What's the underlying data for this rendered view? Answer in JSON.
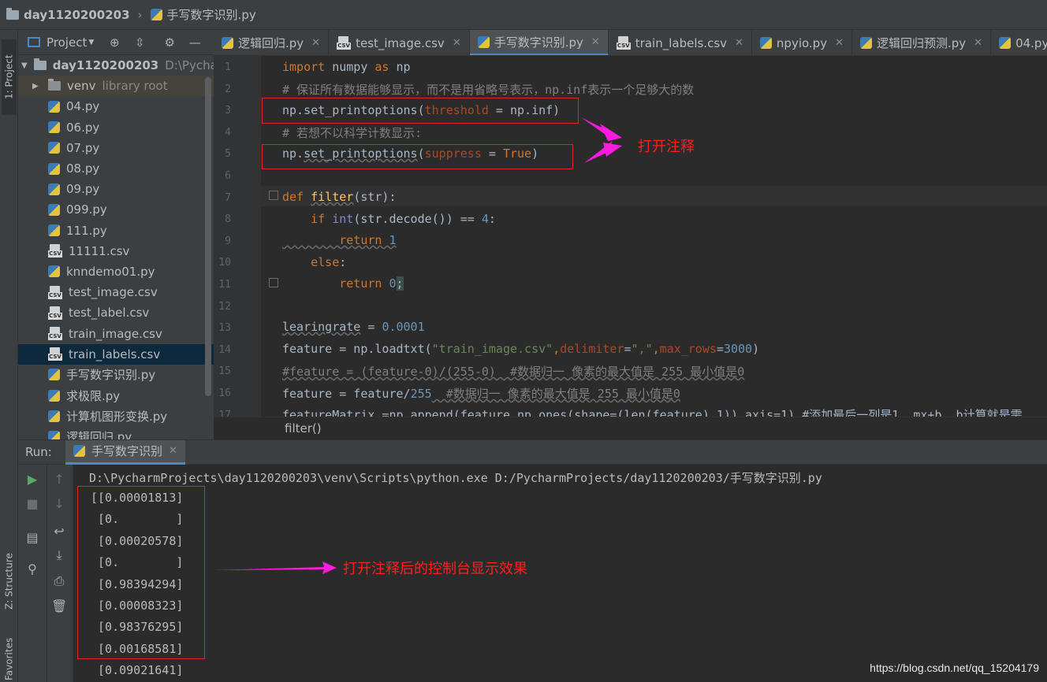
{
  "breadcrumb": {
    "project": "day1120200203",
    "file": "手写数字识别.py"
  },
  "side_tabs": {
    "project": "1: Project",
    "structure": "Z: Structure",
    "favorites": "Favorites"
  },
  "project_panel": {
    "title": "Project",
    "root": {
      "name": "day1120200203",
      "path": "D:\\Pycharm"
    },
    "venv": {
      "name": "venv",
      "hint": "library root"
    },
    "files": [
      {
        "name": "04.py",
        "type": "py"
      },
      {
        "name": "06.py",
        "type": "py"
      },
      {
        "name": "07.py",
        "type": "py"
      },
      {
        "name": "08.py",
        "type": "py"
      },
      {
        "name": "09.py",
        "type": "py"
      },
      {
        "name": "099.py",
        "type": "py"
      },
      {
        "name": "111.py",
        "type": "py"
      },
      {
        "name": "11111.csv",
        "type": "csv"
      },
      {
        "name": "knndemo01.py",
        "type": "py"
      },
      {
        "name": "test_image.csv",
        "type": "csv"
      },
      {
        "name": "test_label.csv",
        "type": "csv"
      },
      {
        "name": "train_image.csv",
        "type": "csv"
      },
      {
        "name": "train_labels.csv",
        "type": "csv",
        "selected": true
      },
      {
        "name": "手写数字识别.py",
        "type": "py"
      },
      {
        "name": "求极限.py",
        "type": "py"
      },
      {
        "name": "计算机图形变换.py",
        "type": "py"
      },
      {
        "name": "逻辑回归.py",
        "type": "py"
      }
    ]
  },
  "tabs": [
    {
      "label": "逻辑回归.py",
      "type": "py"
    },
    {
      "label": "test_image.csv",
      "type": "csv"
    },
    {
      "label": "手写数字识别.py",
      "type": "py",
      "active": true
    },
    {
      "label": "train_labels.csv",
      "type": "csv"
    },
    {
      "label": "npyio.py",
      "type": "py"
    },
    {
      "label": "逻辑回归预测.py",
      "type": "py"
    },
    {
      "label": "04.py",
      "type": "py"
    }
  ],
  "editor": {
    "line_numbers": [
      "1",
      "2",
      "3",
      "4",
      "5",
      "6",
      "7",
      "8",
      "9",
      "10",
      "11",
      "12",
      "13",
      "14",
      "15",
      "16",
      "17"
    ],
    "code": {
      "l1_kw": "import",
      "l1_rest": " numpy ",
      "l1_as": "as",
      "l1_np": " np",
      "l2": "# 保证所有数据能够显示，而不是用省略号表示，np.inf表示一个足够大的数",
      "l3_a": "np.",
      "l3_fn": "set_printoptions",
      "l3_b": "(",
      "l3_param": "threshold",
      "l3_c": " = np.inf)",
      "l4": "# 若想不以科学计数显示:",
      "l5_a": "np.",
      "l5_fn": "set_printoptions",
      "l5_b": "(",
      "l5_param": "suppress",
      "l5_c": " = ",
      "l5_val": "True",
      "l5_d": ")",
      "l7_kw": "def",
      "l7_fn": "filter",
      "l7_rest": "(str):",
      "l8_kw": "if",
      "l8_bi": "int",
      "l8_a": "(str.decode()) == ",
      "l8_num": "4",
      "l8_b": ":",
      "l9_kw": "return",
      "l9_num": "1",
      "l10_kw": "else",
      "l11_kw": "return",
      "l11_num": "0",
      "l13_a": "learingrate",
      "l13_b": " = ",
      "l13_num": "0.0001",
      "l14_a": "feature = np.loadtxt(",
      "l14_s1": "\"train_image.csv\"",
      "l14_b": ",",
      "l14_p1": "delimiter",
      "l14_c": "=",
      "l14_s2": "\",\"",
      "l14_d": ",",
      "l14_p2": "max_rows",
      "l14_e": "=",
      "l14_num": "3000",
      "l14_f": ")",
      "l15": "#feature = (feature-0)/(255-0)  #数据归一 像素的最大值是 255 最小值是0",
      "l16_a": "feature = feature/",
      "l16_num": "255",
      "l16_cm": "  #数据归一 像素的最大值是 255 最小值是0",
      "l17": "featureMatrix =np.append(feature,np.ones(shape=(len(feature),1)),axis=1) #添加最后一列是1  mx+b  b计算就是需"
    },
    "annotation": "打开注释",
    "breadcrumb": "filter()"
  },
  "run": {
    "label": "Run:",
    "tab": "手写数字识别",
    "command": "D:\\PycharmProjects\\day1120200203\\venv\\Scripts\\python.exe D:/PycharmProjects/day1120200203/手写数字识别.py",
    "output": [
      "[[0.00001813]",
      " [0.        ]",
      " [0.00020578]",
      " [0.        ]",
      " [0.98394294]",
      " [0.00008323]",
      " [0.98376295]",
      " [0.00168581]",
      " [0.09021641]"
    ],
    "annotation": "打开注释后的控制台显示效果"
  },
  "watermark": "https://blog.csdn.net/qq_15204179",
  "colors": {
    "annotation_red": "#ff1e1e",
    "arrow_magenta": "#ff1adf",
    "selection": "#0d293e"
  }
}
